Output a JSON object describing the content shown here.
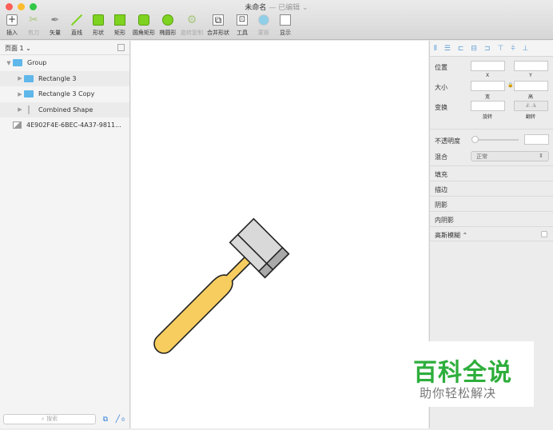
{
  "window": {
    "title": "未命名",
    "status": "— 已编辑 ⌄",
    "colors": {
      "close": "#fc5f57",
      "min": "#fdbc2e",
      "max": "#33c748"
    }
  },
  "toolbar": [
    {
      "label": "插入",
      "icon": "plus-icon",
      "disabled": false
    },
    {
      "label": "剪刀",
      "icon": "scissors-icon",
      "disabled": true
    },
    {
      "label": "矢量",
      "icon": "pen-icon",
      "disabled": false
    },
    {
      "label": "直线",
      "icon": "line-icon",
      "disabled": false
    },
    {
      "label": "形状",
      "icon": "shapes-icon",
      "disabled": false
    },
    {
      "label": "矩形",
      "icon": "rectangle-icon",
      "disabled": false
    },
    {
      "label": "圆角矩形",
      "icon": "rounded-rectangle-icon",
      "disabled": false
    },
    {
      "label": "椭圆形",
      "icon": "oval-icon",
      "disabled": false
    },
    {
      "label": "旋转复制",
      "icon": "rotate-copy-icon",
      "disabled": true
    },
    {
      "label": "合并形状",
      "icon": "combine-icon",
      "disabled": false
    },
    {
      "label": "工具",
      "icon": "tools-icon",
      "disabled": false
    },
    {
      "label": "蒙板",
      "icon": "mask-icon",
      "disabled": true
    },
    {
      "label": "显示",
      "icon": "view-icon",
      "disabled": false
    }
  ],
  "layers": {
    "page": "页面 1 ⌄",
    "items": [
      {
        "name": "Group",
        "level": 0,
        "type": "folder"
      },
      {
        "name": "Rectangle 3",
        "level": 1,
        "type": "folder"
      },
      {
        "name": "Rectangle 3 Copy",
        "level": 1,
        "type": "folder"
      },
      {
        "name": "Combined Shape",
        "level": 1,
        "type": "shape"
      },
      {
        "name": "4E902F4E-6BEC-4A37-9811...",
        "level": 0,
        "type": "image"
      }
    ],
    "search_placeholder": "搜索",
    "count": "0"
  },
  "inspector": {
    "position": "位置",
    "x": "X",
    "y": "Y",
    "size": "大小",
    "w": "宽",
    "h": "高",
    "transform": "变换",
    "rotate": "旋转",
    "flip": "翻转",
    "opacity": "不透明度",
    "blend": "混合",
    "blend_value": "正常",
    "fill": "填充",
    "border": "描边",
    "shadow": "阴影",
    "inner_shadow": "内阴影",
    "blur": "高斯模糊 ⌃"
  },
  "watermark": {
    "title": "百科全说",
    "subtitle": "助你轻松解决"
  }
}
